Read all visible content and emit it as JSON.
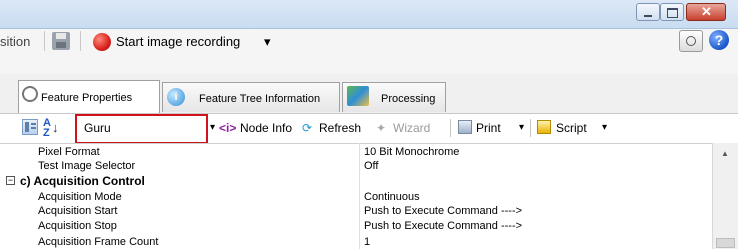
{
  "toolbar": {
    "partial_label": "sition",
    "record_label": "Start image recording",
    "record_dropdown": "▾"
  },
  "tabs": [
    {
      "label": "Feature Properties"
    },
    {
      "label": "Feature Tree Information"
    },
    {
      "label": "Processing"
    }
  ],
  "prop_toolbar": {
    "visibility_value": "Guru",
    "node_info_label": "Node Info",
    "refresh_label": "Refresh",
    "wizard_label": "Wizard",
    "print_label": "Print",
    "script_label": "Script"
  },
  "grid": {
    "rows": [
      {
        "name": "Pixel Format",
        "value": "10 Bit Monochrome"
      },
      {
        "name": "Test Image Selector",
        "value": "Off"
      },
      {
        "name": "c) Acquisition Control",
        "value": ""
      },
      {
        "name": "Acquisition Mode",
        "value": "Continuous"
      },
      {
        "name": "Acquisition Start",
        "value": "Push to Execute Command ---->"
      },
      {
        "name": "Acquisition Stop",
        "value": "Push to Execute Command ---->"
      },
      {
        "name": "Acquisition Frame Count",
        "value": "1"
      }
    ]
  },
  "icons": {
    "gear": "gear-icon",
    "info": "info-icon",
    "processing": "processing-icon",
    "record": "record-icon",
    "save": "save-icon",
    "help": "help-icon",
    "camera": "camera-icon"
  },
  "colors": {
    "highlight_border": "#d0121b",
    "record_red": "#d9211c",
    "help_blue": "#1a56c8"
  }
}
